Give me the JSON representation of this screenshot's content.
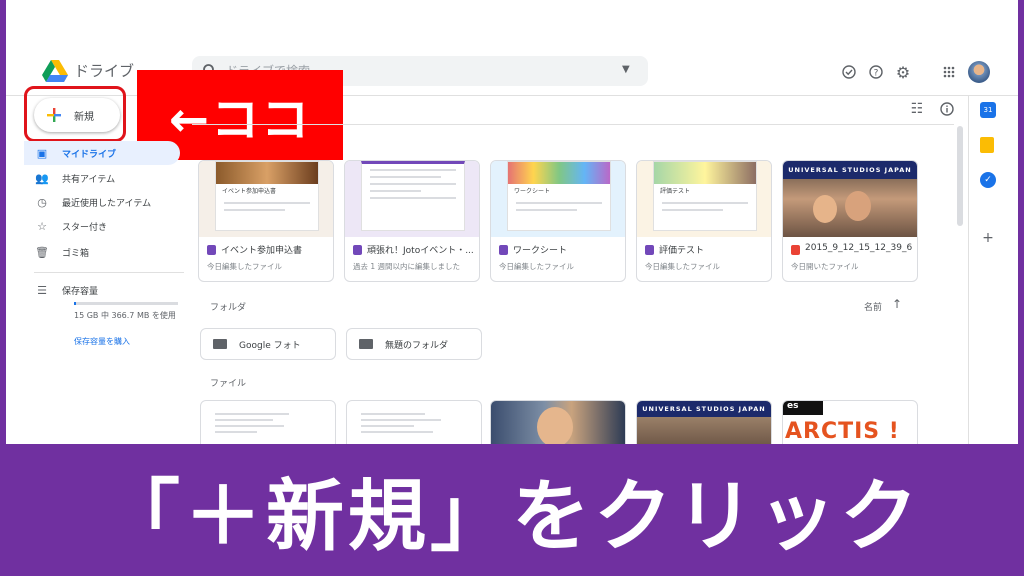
{
  "app": {
    "title": "ドライブ"
  },
  "search": {
    "placeholder": "ドライブで検索"
  },
  "new_button": {
    "label": "新規"
  },
  "annotation": {
    "arrow_label": "←ココ"
  },
  "banner": {
    "text": "「＋新規」をクリック"
  },
  "sidebar": {
    "items": [
      {
        "icon": "my-drive-icon",
        "label": "マイドライブ"
      },
      {
        "icon": "shared-icon",
        "label": "共有アイテム"
      },
      {
        "icon": "clock-icon",
        "label": "最近使用したアイテム"
      },
      {
        "icon": "star-icon",
        "label": "スター付き"
      },
      {
        "icon": "trash-icon",
        "label": "ゴミ箱"
      },
      {
        "icon": "storage-icon",
        "label": "保存容量"
      }
    ],
    "storage_used": "15 GB 中 366.7 MB を使用",
    "storage_used_fraction": 0.024,
    "buy_storage": "保存容量を購入"
  },
  "quick_access": [
    {
      "title": "イベント参加申込書",
      "subtitle": "今日編集したファイル",
      "type": "form"
    },
    {
      "title": "頑張れ！Jotoイベント・...",
      "subtitle": "過去 1 週間以内に編集しました",
      "type": "form"
    },
    {
      "title": "ワークシート",
      "subtitle": "今日編集したファイル",
      "type": "form"
    },
    {
      "title": "評価テスト",
      "subtitle": "今日編集したファイル",
      "type": "form"
    },
    {
      "title": "2015_9_12_15_12_39_6...",
      "subtitle": "今日開いたファイル",
      "type": "image"
    }
  ],
  "thumb_text": {
    "form1": "イベント参加申込書",
    "form3": "ワークシート",
    "form4": "評価テスト",
    "usj": "UNIVERSAL STUDIOS JAPAN",
    "arctis": "ARCTIS !",
    "arctis_top": "es"
  },
  "sections": {
    "folders": "フォルダ",
    "files": "ファイル",
    "sort": "名前"
  },
  "folders": [
    {
      "name": "Google フォト"
    },
    {
      "name": "無題のフォルダ"
    }
  ],
  "colors": {
    "accent": "#1a73e8",
    "highlight": "#ff0000",
    "banner": "#7030a0",
    "form": "#7248b9"
  }
}
